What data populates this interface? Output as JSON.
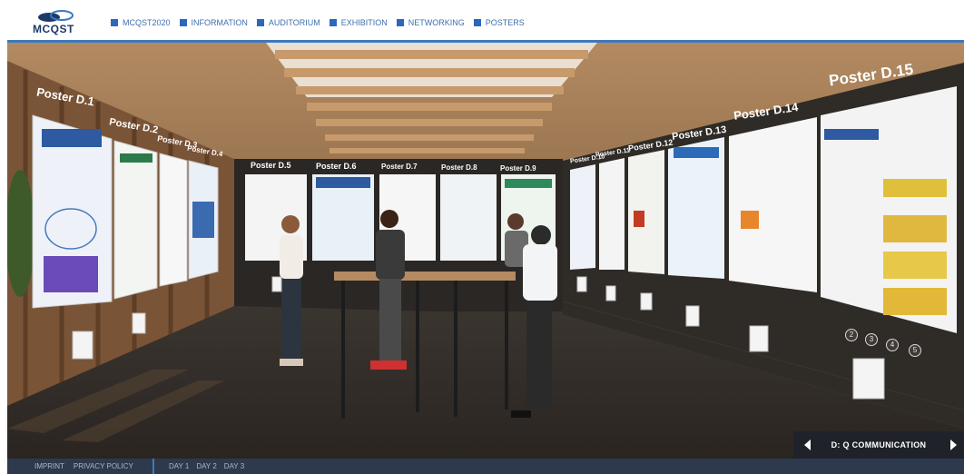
{
  "header": {
    "logo_text": "MCQST",
    "nav": [
      "MCQST2020",
      "INFORMATION",
      "AUDITORIUM",
      "EXHIBITION",
      "NETWORKING",
      "POSTERS"
    ]
  },
  "posters": {
    "left": [
      "Poster D.1",
      "Poster D.2",
      "Poster D.3",
      "Poster D.4"
    ],
    "back": [
      "Poster D.5",
      "Poster D.6",
      "Poster D.7",
      "Poster D.8",
      "Poster D.9"
    ],
    "right": [
      "Poster D.10",
      "Poster D.11",
      "Poster D.12",
      "Poster D.13",
      "Poster D.14",
      "Poster D.15"
    ],
    "page_numbers": [
      "2",
      "3",
      "4",
      "5"
    ]
  },
  "hall_nav": {
    "label": "D: Q COMMUNICATION"
  },
  "footer": {
    "links": [
      "IMPRINT",
      "PRIVACY POLICY"
    ],
    "days": [
      "DAY 1",
      "DAY 2",
      "DAY 3"
    ]
  },
  "colors": {
    "accent": "#3a7ac0",
    "nav_text": "#3f6fad",
    "footer_bg": "#2d3a4d"
  }
}
